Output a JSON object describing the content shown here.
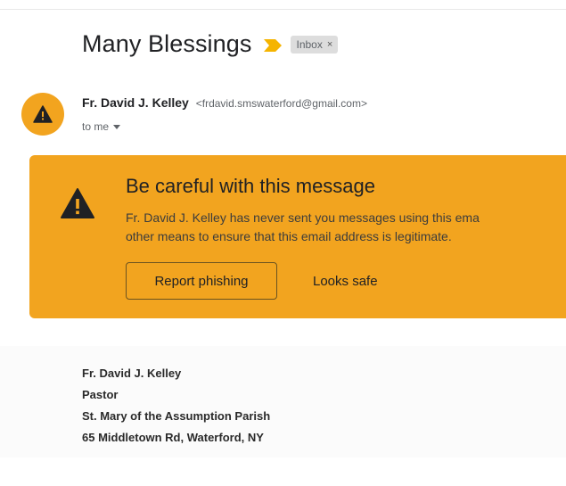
{
  "email": {
    "subject": "Many Blessings",
    "label_chip": "Inbox",
    "label_chip_close": "×",
    "sender_name": "Fr. David J. Kelley",
    "sender_email": "<frdavid.smswaterford@gmail.com>",
    "recipient_line": "to me"
  },
  "warning": {
    "title": "Be careful with this message",
    "body": "Fr. David J. Kelley has never sent you messages using this ema\nother means to ensure that this email address is legitimate.",
    "report_label": "Report phishing",
    "safe_label": "Looks safe"
  },
  "signature": {
    "line1": "Fr. David J. Kelley",
    "line2": "Pastor",
    "line3": "St. Mary of the Assumption Parish",
    "line4": "65 Middletown Rd, Waterford, NY"
  },
  "colors": {
    "warning_background": "#f2a41f",
    "importance_marker": "#f5b400",
    "chip_background": "#dddddd"
  },
  "icons": {
    "importance": "importance-marker-icon",
    "avatar": "warning-triangle-icon",
    "banner": "warning-triangle-icon",
    "recipient_details": "caret-down-icon",
    "chip_close": "close-icon"
  }
}
